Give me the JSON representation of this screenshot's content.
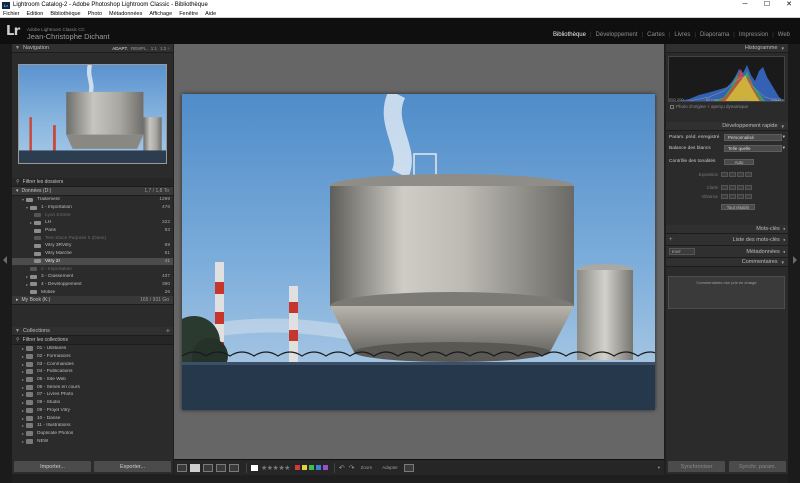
{
  "window": {
    "title": "Lightroom Catalog-2 - Adobe Photoshop Lightroom Classic - Bibliothèque",
    "app_badge": "Lr",
    "controls": [
      "─",
      "☐",
      "✕"
    ]
  },
  "menu": [
    "Fichier",
    "Edition",
    "Bibliothèque",
    "Photo",
    "Métadonnées",
    "Affichage",
    "Fenêtre",
    "Aide"
  ],
  "identity": {
    "logo": "Lr",
    "product": "Adobe Lightroom Classic CC",
    "user": "Jean-Christophe Dichant"
  },
  "modules": {
    "items": [
      "Bibliothèque",
      "Développement",
      "Cartes",
      "Livres",
      "Diaporama",
      "Impression",
      "Web"
    ],
    "active": "Bibliothèque"
  },
  "navigator": {
    "title": "Navigation",
    "zoom_options": [
      "ADAPT.",
      "REMPL.",
      "1:1",
      "1:2 ÷"
    ]
  },
  "folders": {
    "filter": "Filtrer les dossiers",
    "volume_label": "Données (D:)",
    "volume_info": "1,7 / 1,8 To",
    "rows": [
      {
        "indent": 2,
        "toggle": "▾",
        "name": "Traitement",
        "count": "1299",
        "faded": false,
        "selected": false
      },
      {
        "indent": 3,
        "toggle": "▾",
        "name": "1 - Importation",
        "count": "476",
        "faded": false,
        "selected": false
      },
      {
        "indent": 4,
        "toggle": "",
        "name": "Lyon Entrée",
        "count": "",
        "faded": true,
        "selected": false
      },
      {
        "indent": 4,
        "toggle": "▸",
        "name": "LH",
        "count": "222",
        "faded": false,
        "selected": false
      },
      {
        "indent": 4,
        "toggle": "",
        "name": "Paris",
        "count": "93",
        "faded": false,
        "selected": false
      },
      {
        "indent": 4,
        "toggle": "",
        "name": "Test Stuck Purpose II (Dans)",
        "count": "",
        "faded": true,
        "selected": false
      },
      {
        "indent": 4,
        "toggle": "",
        "name": "Vitry 3RVitry",
        "count": "69",
        "faded": false,
        "selected": false
      },
      {
        "indent": 4,
        "toggle": "",
        "name": "Vitry Marché",
        "count": "51",
        "faded": false,
        "selected": false
      },
      {
        "indent": 4,
        "toggle": "",
        "name": "Vitry 2I",
        "count": "41",
        "faded": false,
        "selected": true
      },
      {
        "indent": 3,
        "toggle": "",
        "name": "2 - Importation",
        "count": "",
        "faded": true,
        "selected": false
      },
      {
        "indent": 3,
        "toggle": "▸",
        "name": "3 - Classement",
        "count": "437",
        "faded": false,
        "selected": false
      },
      {
        "indent": 3,
        "toggle": "▸",
        "name": "4 - Développement",
        "count": "390",
        "faded": false,
        "selected": false
      },
      {
        "indent": 3,
        "toggle": "",
        "name": "Mobile",
        "count": "26",
        "faded": false,
        "selected": false
      }
    ],
    "volume2_label": "My Book (K:)",
    "volume2_info": "165 / 931 Go"
  },
  "collections": {
    "title": "Collections",
    "filter": "Filtrer les collections",
    "rows": [
      "01 - Utilitaires",
      "02 - Formations",
      "03 - Commandes",
      "04 - Publications",
      "05 - Site Web",
      "06 - Séries en cours",
      "07 - Livres Photo",
      "08 - Studio",
      "09 - Projet Vitry",
      "10 - Danse",
      "11 - Illustrations",
      "Duplicate Photos",
      "NEW"
    ]
  },
  "left_buttons": {
    "import": "Importer...",
    "export": "Exporter..."
  },
  "histogram": {
    "title": "Histogramme",
    "iso": "ISO 200",
    "focal": "62 mm",
    "aperture": "f / 11",
    "shutter": "1/200 s",
    "original": "Photo d'origine + aperçu dynamique"
  },
  "quick_develop": {
    "title": "Développement rapide",
    "preset_label": "Param. préd. enregistré",
    "preset_value": "Personnalisé",
    "wb_label": "Balance des blancs",
    "wb_value": "Telle quelle",
    "tone_label": "Contrôle des tonalités",
    "auto_label": "Auto",
    "rows": [
      "Exposition",
      "Clarté",
      "Vibrance"
    ],
    "reset": "Tout rétablir"
  },
  "right_sections": {
    "keywords": "Mots-clés",
    "keyword_list": "Liste des mots-clés",
    "metadata_preset": "EXIF",
    "metadata": "Métadonnées",
    "comments": "Commentaires",
    "comments_text": "Commentaires non pris en charge"
  },
  "right_buttons": {
    "sync_meta": "Synchroniser",
    "sync_settings": "Synchr. param."
  },
  "toolbar": {
    "stars": "★★★★★",
    "zoom_label": "Zoom",
    "fit_label": "Adapter",
    "label_colors": [
      "#d33b3b",
      "#e6d33b",
      "#3fbf4c",
      "#3f7fd6",
      "#9b4fcf"
    ]
  },
  "accent": {
    "panel": "#2b2b2b",
    "center": "#666666",
    "selection": "#4c4c4c"
  }
}
